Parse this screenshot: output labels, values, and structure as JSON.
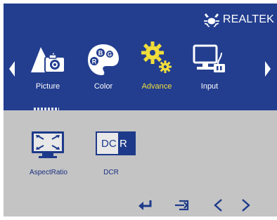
{
  "brand": {
    "logo_icon": "realtek-crab-logo-icon",
    "text": "REALTEK"
  },
  "nav": {
    "left_arrow_icon": "triangle-left-icon",
    "right_arrow_icon": "triangle-right-icon"
  },
  "menu": {
    "items": [
      {
        "label": "Picture",
        "icon": "picture-icon"
      },
      {
        "label": "Color",
        "icon": "palette-icon"
      },
      {
        "label": "Advance",
        "icon": "gears-icon",
        "selected": true
      },
      {
        "label": "Input",
        "icon": "monitor-input-icon"
      }
    ]
  },
  "submenu": {
    "items": [
      {
        "label": "AspectRatio",
        "icon": "aspect-ratio-icon"
      },
      {
        "label": "DCR",
        "icon": "dcr-icon",
        "icon_text_left": "DC",
        "icon_text_right": "R"
      }
    ]
  },
  "controls": {
    "enter_icon": "enter-icon",
    "exit_icon": "exit-icon",
    "prev_icon": "chevron-left-icon",
    "next_icon": "chevron-right-icon"
  },
  "colors": {
    "header_bg": "#233e8f",
    "body_bg": "#c4c4c4",
    "accent_selected": "#f2de3a",
    "icon_blue": "#1d3a8a"
  }
}
